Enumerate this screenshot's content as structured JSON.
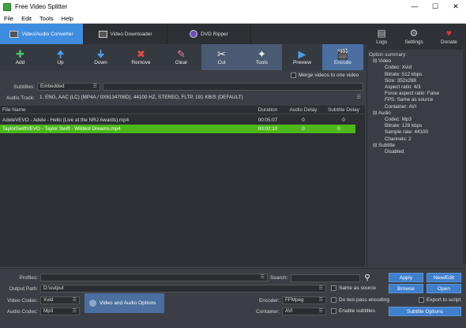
{
  "window": {
    "title": "Free Video Splitter"
  },
  "menu": [
    "File",
    "Edit",
    "Tools",
    "Help"
  ],
  "tabs": [
    {
      "label": "Video/Audio Converter",
      "active": true
    },
    {
      "label": "Video Downloader",
      "active": false
    },
    {
      "label": "DVD Ripper",
      "active": false
    }
  ],
  "top_right": [
    {
      "label": "Logs",
      "icon": "logs-icon"
    },
    {
      "label": "Settings",
      "icon": "gear-icon"
    },
    {
      "label": "Donate",
      "icon": "heart-icon"
    }
  ],
  "toolbar": {
    "add": "Add",
    "up": "Up",
    "down": "Down",
    "remove": "Remove",
    "clear": "Clear",
    "cut": "Cut",
    "tools": "Tools",
    "preview": "Preview",
    "encode": "Encode"
  },
  "merge_label": "Merge videos to one video",
  "subtitles": {
    "label": "Subtitles:",
    "value": "Embedded"
  },
  "audio_track": {
    "label": "Audio Track:",
    "value": "1. ENG, AAC (LC) (MP4A / 0X6134706D), 44100 HZ, STEREO, FLTP, 191 KB/S (DEFAULT)"
  },
  "filelist": {
    "headers": [
      "File Name",
      "Duration",
      "Audio Delay",
      "Subtitle Delay"
    ],
    "rows": [
      {
        "name": "AdeleVEVO - Adele - Hello (Live at the NRJ Awards).mp4",
        "duration": "00:05:07",
        "audio_delay": "0",
        "subtitle_delay": "0",
        "selected": false
      },
      {
        "name": "TaylorSwiftVEVO - Taylor Swift - Wildest Dreams.mp4",
        "duration": "00:02:10",
        "audio_delay": "0",
        "subtitle_delay": "0",
        "selected": true
      }
    ]
  },
  "summary": {
    "title": "Option summary:",
    "sections": [
      {
        "name": "Video",
        "items": [
          "Codec: Xvid",
          "Bitrate: 512 kbps",
          "Size: 352x288",
          "Aspect ratio: 4/3",
          "Force aspect ratio: False",
          "FPS: Same as source",
          "Container: AVI"
        ]
      },
      {
        "name": "Audio",
        "items": [
          "Codec: Mp3",
          "Bitrate: 128 kbps",
          "Sample rate: 44100",
          "Channels: 2"
        ]
      },
      {
        "name": "Subtitle",
        "items": [
          "Disabled"
        ]
      }
    ]
  },
  "bottom": {
    "profiles_label": "Profiles:",
    "search_label": "Search:",
    "output_label": "Output Path:",
    "output_value": "D:\\output",
    "same_as_source": "Same as source",
    "video_codec_label": "Video Codec:",
    "video_codec_value": "Xvid",
    "audio_codec_label": "Audio Codec:",
    "audio_codec_value": "Mp3",
    "va_options": "Video and Audio Options",
    "encoder_label": "Encoder:",
    "encoder_value": "FFMpeg",
    "container_label": "Container:",
    "container_value": "AVI",
    "two_pass": "Do two pass encoding",
    "enable_subs": "Enable subtitles",
    "apply": "Apply",
    "new_edit": "New/Edit",
    "browse": "Browse",
    "open": "Open",
    "export_script": "Export to script",
    "subtitle_options": "Subtitle Options"
  },
  "colors": {
    "accent": "#3f8de0",
    "selected_row": "#4cb81a",
    "bg": "#3b3f45"
  }
}
